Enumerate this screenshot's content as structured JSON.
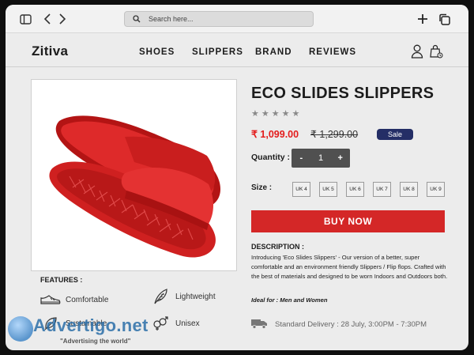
{
  "browser": {
    "search_placeholder": "Search here..."
  },
  "nav": {
    "logo": "Zitiva",
    "links": [
      "SHOES",
      "SLIPPERS",
      "BRAND",
      "REVIEWS"
    ]
  },
  "product": {
    "title": "ECO SLIDES SLIPPERS",
    "stars": "★★★★★",
    "price": "₹ 1,099.00",
    "old_price": "₹ 1,299.00",
    "badge": "Sale",
    "quantity_label": "Quantity :",
    "quantity_minus": "-",
    "quantity_value": "1",
    "quantity_plus": "+",
    "size_label": "Size :",
    "sizes": [
      "UK 4",
      "UK 5",
      "UK 6",
      "UK 7",
      "UK 8",
      "UK 9"
    ],
    "buy_label": "BUY NOW",
    "description_heading": "DESCRIPTION :",
    "description": "Introducing 'Eco Slides Slippers' - Our version of a better, super comfortable and an environment friendly Slippers / Flip flops. Crafted with the best of materials and designed to be worn Indoors and Outdoors both.",
    "ideal_for": "Ideal for : Men and Women"
  },
  "features": {
    "heading": "FEATURES :",
    "items": [
      "Comfortable",
      "Lightweight",
      "Sustainable",
      "Unisex"
    ]
  },
  "delivery": "Standard Delivery : 28 July, 3:00PM - 7:30PM",
  "watermark": {
    "main": "Advertigo.net",
    "sub": "\"Advertising the world\""
  },
  "colors": {
    "accent_red": "#d42727",
    "sale_badge": "#242e66",
    "price_red": "#e31c1c"
  }
}
